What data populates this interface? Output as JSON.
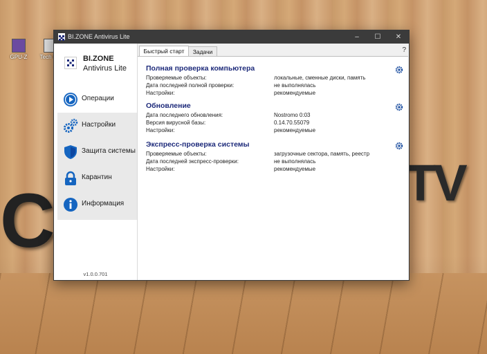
{
  "desktop": {
    "icons": [
      {
        "label": "GPU-Z",
        "icon": "gpuz-icon"
      },
      {
        "label": "Tech GP",
        "icon": "app-icon"
      }
    ],
    "watermark_left": "C",
    "watermark_right": "TV"
  },
  "window": {
    "title": "BI.ZONE Antivirus Lite",
    "controls": {
      "minimize": "–",
      "maximize": "☐",
      "close": "✕"
    }
  },
  "sidebar": {
    "brand_line1": "BI.ZONE",
    "brand_line2": "Antivirus Lite",
    "items": [
      {
        "label": "Операции",
        "icon": "play-icon",
        "active": true
      },
      {
        "label": "Настройки",
        "icon": "gears-icon",
        "active": false
      },
      {
        "label": "Защита системы",
        "icon": "shield-icon",
        "active": false
      },
      {
        "label": "Карантин",
        "icon": "lock-icon",
        "active": false
      },
      {
        "label": "Информация",
        "icon": "info-icon",
        "active": false
      }
    ],
    "version": "v1.0.0.701"
  },
  "tabs": [
    {
      "label": "Быстрый старт",
      "active": true
    },
    {
      "label": "Задачи",
      "active": false
    }
  ],
  "help": "?",
  "sections": [
    {
      "title": "Полная проверка компьютера",
      "rows": [
        {
          "label": "Проверяемые объекты:",
          "value": "локальные, сменные диски, память"
        },
        {
          "label": "Дата последней полной проверки:",
          "value": "не выполнялась"
        },
        {
          "label": "Настройки:",
          "value": "рекомендуемые"
        }
      ]
    },
    {
      "title": "Обновление",
      "rows": [
        {
          "label": "Дата последнего обновления:",
          "value": "Nostromo 0:03"
        },
        {
          "label": "Версия вирусной базы:",
          "value": "0.14.70.55079"
        },
        {
          "label": "Настройки:",
          "value": "рекомендуемые"
        }
      ]
    },
    {
      "title": "Экспресс-проверка системы",
      "rows": [
        {
          "label": "Проверяемые объекты:",
          "value": "загрузочные сектора, память, реестр"
        },
        {
          "label": "Дата последней экспресс-проверки:",
          "value": "не выполнялась"
        },
        {
          "label": "Настройки:",
          "value": "рекомендуемые"
        }
      ]
    }
  ],
  "colors": {
    "accent": "#1d2a7a",
    "icon_blue": "#1565c0",
    "titlebar": "#3b3b3b"
  }
}
